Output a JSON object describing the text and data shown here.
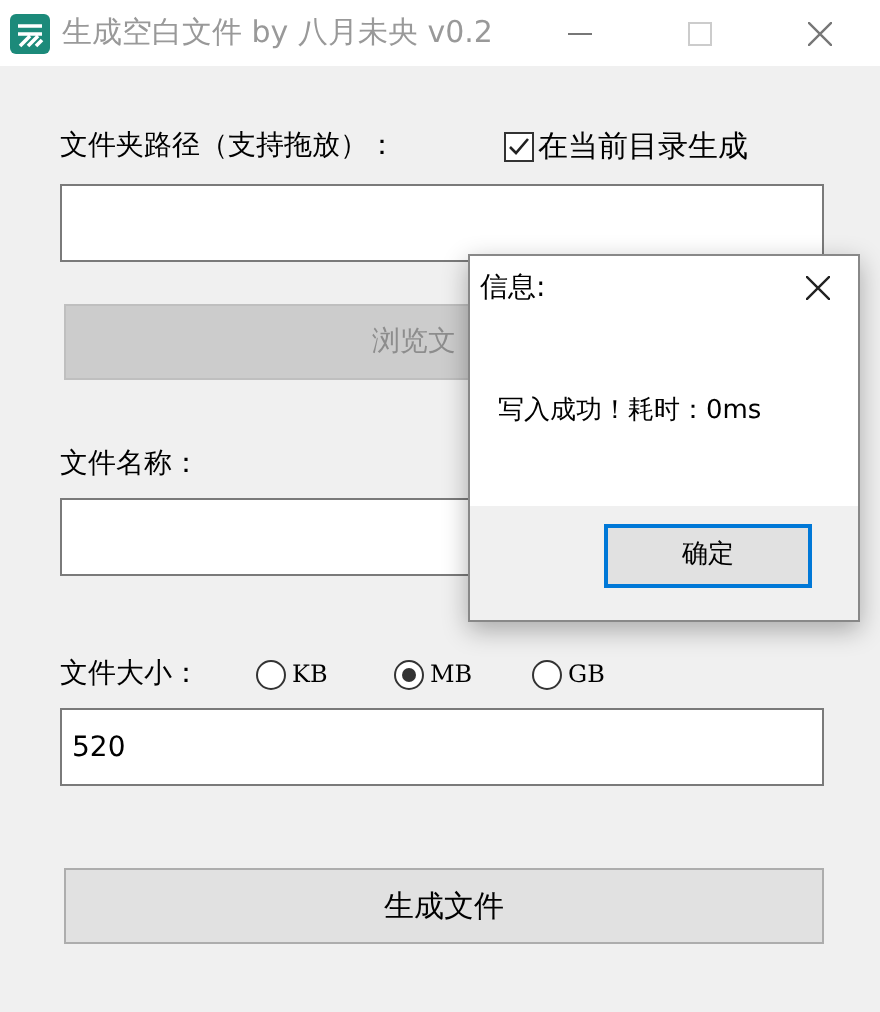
{
  "window": {
    "title": "生成空白文件 by 八月未央 v0.2",
    "active": false
  },
  "folder": {
    "label": "文件夹路径（支持拖放）：",
    "current_dir": {
      "label": "在当前目录生成",
      "checked": true
    },
    "browse_button": {
      "label": "浏览文",
      "disabled": true
    }
  },
  "file_name": {
    "label": "文件名称："
  },
  "file_size": {
    "label": "文件大小：",
    "units": [
      {
        "label": "KB",
        "selected": false
      },
      {
        "label": "MB",
        "selected": true
      },
      {
        "label": "GB",
        "selected": false
      }
    ],
    "value": "520"
  },
  "generate_button": "生成文件",
  "dialog": {
    "title": "信息:",
    "message": "写入成功！耗时：0ms",
    "ok_button": "确定"
  }
}
